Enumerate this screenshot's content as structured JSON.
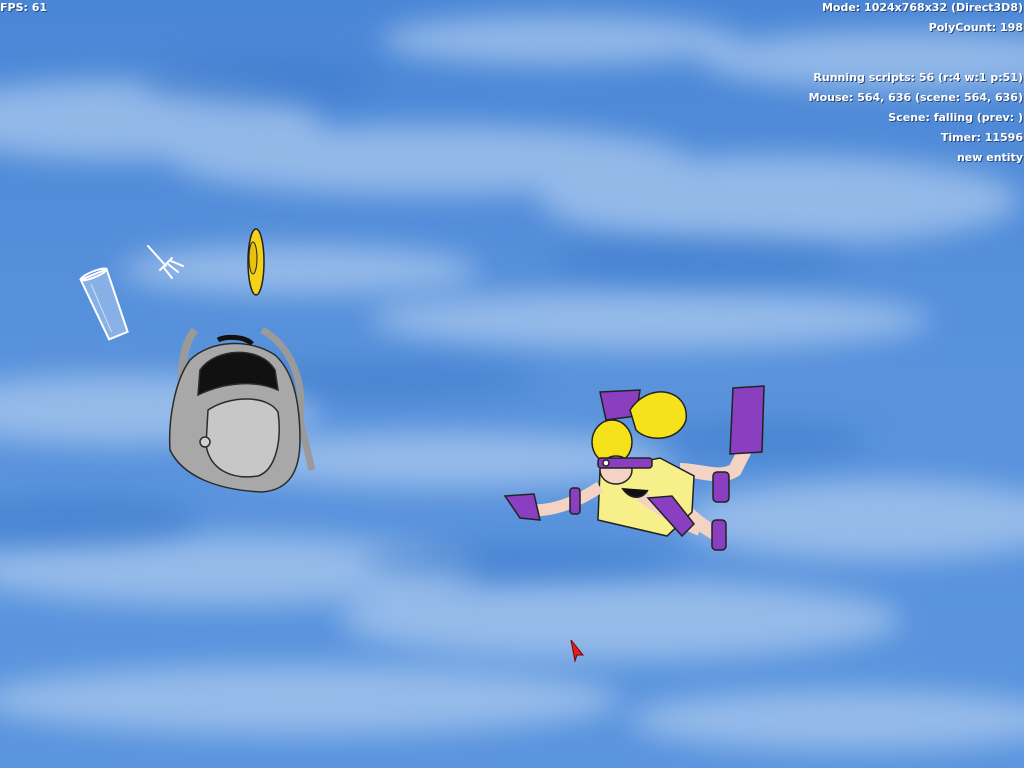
{
  "hud": {
    "fps": "FPS: 61",
    "mode": "Mode: 1024x768x32 (Direct3D8)",
    "polycount": "PolyCount: 198",
    "running_scripts": "Running scripts: 56 (r:4 w:1 p:51)",
    "mouse": "Mouse: 564, 636 (scene: 564, 636)",
    "scene": "Scene: falling (prev: )",
    "timer": "Timer: 11596",
    "entity": "new entity"
  },
  "scene": {
    "background": "sky-with-clouds",
    "objects": [
      "glass-cup",
      "fork",
      "yellow-hat",
      "grey-backpack",
      "skydiving-girl",
      "red-mouse-cursor"
    ]
  },
  "colors": {
    "sky": "#4a86d4",
    "hair": "#f5e21a",
    "costume_purple": "#8a3fc0",
    "cursor": "#e02020"
  }
}
